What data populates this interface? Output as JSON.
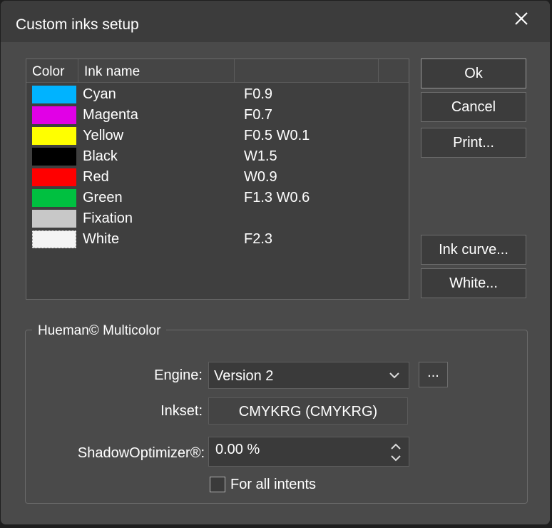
{
  "window": {
    "title": "Custom inks setup"
  },
  "ink_table": {
    "columns": [
      "Color",
      "Ink name",
      ""
    ],
    "rows": [
      {
        "color": "#00b3ff",
        "name": "Cyan",
        "value": "F0.9"
      },
      {
        "color": "#e100e6",
        "name": "Magenta",
        "value": "F0.7"
      },
      {
        "color": "#ffff00",
        "name": "Yellow",
        "value": "F0.5 W0.1"
      },
      {
        "color": "#000000",
        "name": "Black",
        "value": "W1.5"
      },
      {
        "color": "#ff0000",
        "name": "Red",
        "value": "W0.9"
      },
      {
        "color": "#00c040",
        "name": "Green",
        "value": "F1.3 W0.6"
      },
      {
        "color": "#c8c8c8",
        "name": "Fixation",
        "value": ""
      },
      {
        "color": "#f4f4f4",
        "name": "White",
        "value": "F2.3"
      }
    ]
  },
  "buttons": {
    "ok": "Ok",
    "cancel": "Cancel",
    "print": "Print...",
    "ink_curve": "Ink curve...",
    "white": "White..."
  },
  "hueman": {
    "group_title": "Hueman© Multicolor",
    "engine_label": "Engine:",
    "engine_value": "Version 2",
    "more_button": "...",
    "inkset_label": "Inkset:",
    "inkset_value": "CMYKRG (CMYKRG)",
    "shadow_label": "ShadowOptimizer®:",
    "shadow_value": "0.00 %",
    "for_all_intents_label": "For all intents",
    "for_all_intents_checked": false
  },
  "icons": {
    "close": "close-icon",
    "engine_dropdown": "chevron-down-icon",
    "spinner": "spinner-arrows-icon"
  }
}
